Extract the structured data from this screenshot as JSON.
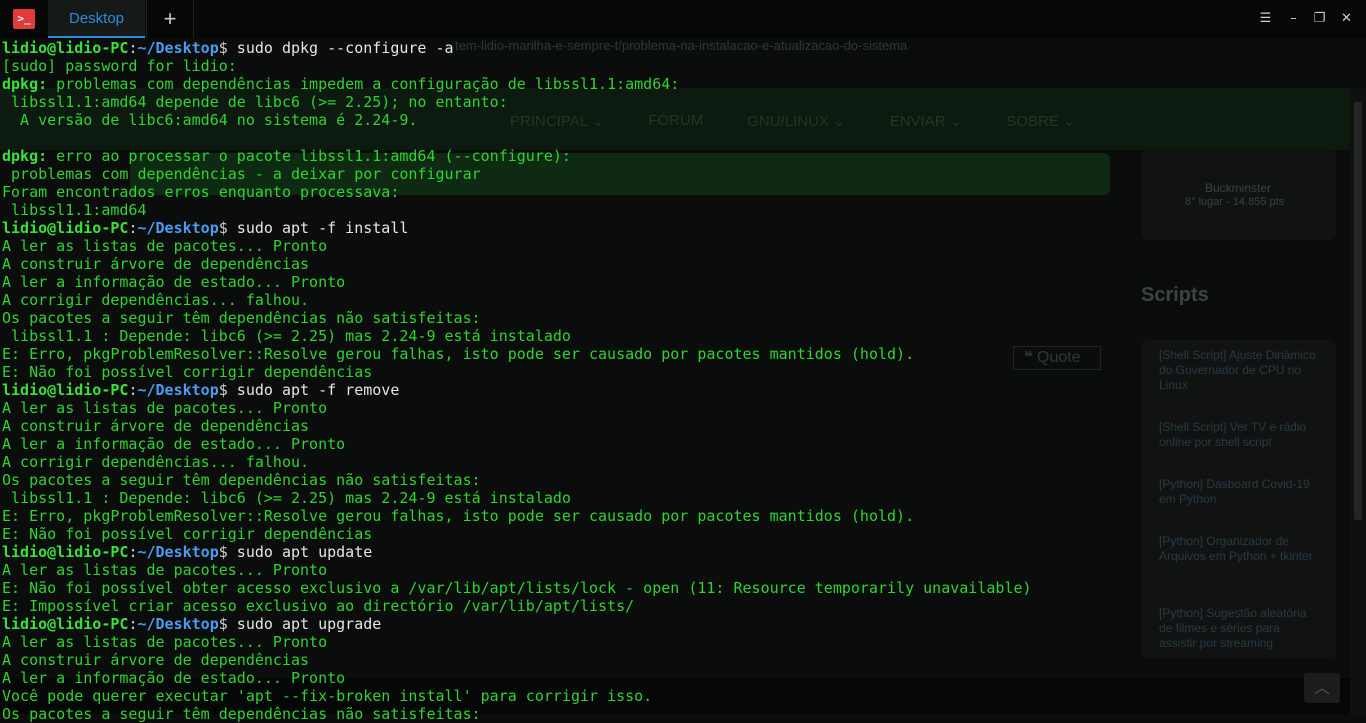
{
  "window": {
    "tab_label": "Desktop",
    "add_tab_label": "+",
    "menu_glyph": "☰",
    "minimize_glyph": "–",
    "restore_glyph": "❐",
    "close_glyph": "✕",
    "app_icon_glyph": ">_"
  },
  "background_page": {
    "url_fragment": "tem-lidio-marilha-e-sempre-t/problema-na-instalacao-e-atualizacao-do-sistema",
    "nav_items": [
      "PRINCIPAL ⌄",
      "FÓRUM",
      "GNU/LINUX ⌄",
      "ENVIAR ⌄",
      "SOBRE ⌄"
    ],
    "user_name": "Buckminster",
    "user_points": "8° lugar - 14.855 pts",
    "scripts_title": "Scripts",
    "script_links": [
      "[Shell Script] Ajuste Dinâmico do Governador de CPU no Linux",
      "[Shell Script] Ver TV e rádio online por shell script",
      "[Python] Dasboard Covid-19 em Python",
      "[Python] Organizador de Arquivos em Python + tkinter",
      "[Python] Sugestão aleatória de filmes e séries para assistir por streaming"
    ],
    "quote_label": "❝ Quote",
    "scroll_up_glyph": "︿"
  },
  "terminal": {
    "prompt_user": "lidio@lidio-PC",
    "prompt_colon": ":",
    "prompt_path": "~/Desktop",
    "prompt_dollar": "$",
    "lines": [
      {
        "type": "prompt",
        "cmd": " sudo dpkg --configure -a"
      },
      {
        "type": "out",
        "text": "[sudo] password for lidio:"
      },
      {
        "type": "dpkg",
        "label": "dpkg:",
        "text": " problemas com dependências impedem a configuração de libssl1.1:amd64:"
      },
      {
        "type": "out",
        "text": " libssl1.1:amd64 depende de libc6 (>= 2.25); no entanto:"
      },
      {
        "type": "out",
        "text": "  A versão de libc6:amd64 no sistema é 2.24-9."
      },
      {
        "type": "out",
        "text": ""
      },
      {
        "type": "dpkg",
        "label": "dpkg:",
        "text": " erro ao processar o pacote libssl1.1:amd64 (--configure):"
      },
      {
        "type": "out",
        "text": " problemas com dependências - a deixar por configurar"
      },
      {
        "type": "out",
        "text": "Foram encontrados erros enquanto processava:"
      },
      {
        "type": "out",
        "text": " libssl1.1:amd64"
      },
      {
        "type": "prompt",
        "cmd": " sudo apt -f install"
      },
      {
        "type": "out",
        "text": "A ler as listas de pacotes... Pronto"
      },
      {
        "type": "out",
        "text": "A construir árvore de dependências"
      },
      {
        "type": "out",
        "text": "A ler a informação de estado... Pronto"
      },
      {
        "type": "out",
        "text": "A corrigir dependências... falhou."
      },
      {
        "type": "out",
        "text": "Os pacotes a seguir têm dependências não satisfeitas:"
      },
      {
        "type": "out",
        "text": " libssl1.1 : Depende: libc6 (>= 2.25) mas 2.24-9 está instalado"
      },
      {
        "type": "out",
        "text": "E: Erro, pkgProblemResolver::Resolve gerou falhas, isto pode ser causado por pacotes mantidos (hold)."
      },
      {
        "type": "out",
        "text": "E: Não foi possível corrigir dependências"
      },
      {
        "type": "prompt",
        "cmd": " sudo apt -f remove"
      },
      {
        "type": "out",
        "text": "A ler as listas de pacotes... Pronto"
      },
      {
        "type": "out",
        "text": "A construir árvore de dependências"
      },
      {
        "type": "out",
        "text": "A ler a informação de estado... Pronto"
      },
      {
        "type": "out",
        "text": "A corrigir dependências... falhou."
      },
      {
        "type": "out",
        "text": "Os pacotes a seguir têm dependências não satisfeitas:"
      },
      {
        "type": "out",
        "text": " libssl1.1 : Depende: libc6 (>= 2.25) mas 2.24-9 está instalado"
      },
      {
        "type": "out",
        "text": "E: Erro, pkgProblemResolver::Resolve gerou falhas, isto pode ser causado por pacotes mantidos (hold)."
      },
      {
        "type": "out",
        "text": "E: Não foi possível corrigir dependências"
      },
      {
        "type": "prompt",
        "cmd": " sudo apt update"
      },
      {
        "type": "out",
        "text": "A ler as listas de pacotes... Pronto"
      },
      {
        "type": "out",
        "text": "E: Não foi possível obter acesso exclusivo a /var/lib/apt/lists/lock - open (11: Resource temporarily unavailable)"
      },
      {
        "type": "out",
        "text": "E: Impossível criar acesso exclusivo ao directório /var/lib/apt/lists/"
      },
      {
        "type": "prompt",
        "cmd": " sudo apt upgrade"
      },
      {
        "type": "out",
        "text": "A ler as listas de pacotes... Pronto"
      },
      {
        "type": "out",
        "text": "A construir árvore de dependências"
      },
      {
        "type": "out",
        "text": "A ler a informação de estado... Pronto"
      },
      {
        "type": "out",
        "text": "Você pode querer executar 'apt --fix-broken install' para corrigir isso."
      },
      {
        "type": "out",
        "text": "Os pacotes a seguir têm dependências não satisfeitas:"
      }
    ]
  }
}
